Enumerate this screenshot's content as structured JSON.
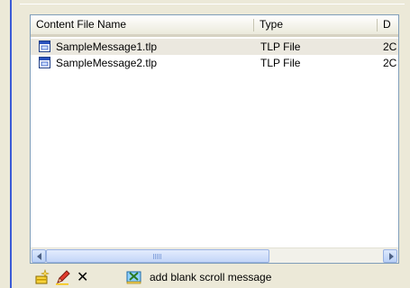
{
  "list": {
    "columns": [
      "Content File Name",
      "Type",
      "D"
    ],
    "rows": [
      {
        "name": "SampleMessage1.tlp",
        "type": "TLP File",
        "date": "2C",
        "selected": true
      },
      {
        "name": "SampleMessage2.tlp",
        "type": "TLP File",
        "date": "2C",
        "selected": false
      }
    ],
    "scrollbar_grip": "III"
  },
  "toolbar": {
    "new_icon": "new-document-sparkle-icon",
    "edit_icon": "pencil-edit-icon",
    "delete_label": "✕",
    "blank_scroll_icon": "blank-scroll-icon",
    "blank_scroll_label": "add blank scroll message"
  },
  "colors": {
    "border": "#7f9db9",
    "selected_row": "#ebe8df",
    "background": "#ece9d8"
  }
}
